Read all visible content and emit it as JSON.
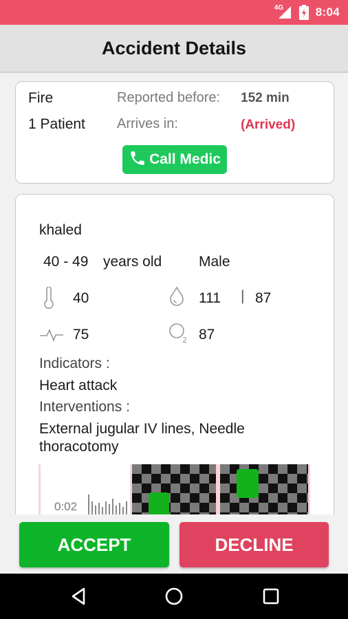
{
  "status_bar": {
    "network": "4G",
    "time": "8:04"
  },
  "app_bar": {
    "title": "Accident Details"
  },
  "summary": {
    "type": "Fire",
    "patients": "1 Patient",
    "reported_label": "Reported before:",
    "reported_value": "152 min",
    "arrives_label": "Arrives in:",
    "arrives_value": "(Arrived)",
    "call_button": "Call Medic"
  },
  "patient": {
    "name": "khaled",
    "age_range": "40 - 49",
    "age_suffix": "years old",
    "gender": "Male",
    "temperature": "40",
    "blood_pressure_systolic": "111",
    "bp_separator": "|",
    "blood_pressure_diastolic": "87",
    "pulse": "75",
    "oxygen": "87",
    "indicators_label": "Indicators :",
    "indicators_value": "Heart attack",
    "interventions_label": "Interventions :",
    "interventions_line1": "External jugular IV lines, Needle",
    "interventions_line2": "thoracotomy"
  },
  "media": {
    "audio_duration": "0:02"
  },
  "actions": {
    "accept": "ACCEPT",
    "decline": "DECLINE"
  },
  "colors": {
    "status_bar": "#ec5168",
    "accept": "#0db429",
    "decline": "#e0435f",
    "call": "#1ec95c",
    "arrived": "#e0354f"
  },
  "icons": [
    "signal-icon",
    "battery-icon",
    "phone-icon",
    "thermometer-icon",
    "blood-drop-icon",
    "pulse-icon",
    "oxygen-icon",
    "back-icon",
    "home-icon",
    "recents-icon"
  ]
}
